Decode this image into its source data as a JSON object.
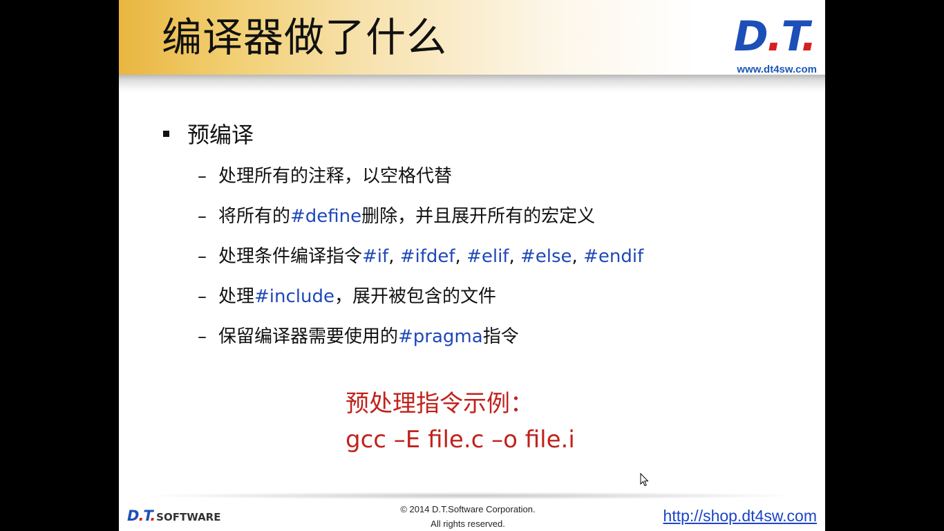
{
  "slide": {
    "title": "编译器做了什么",
    "logo": {
      "letters_blue": "D",
      "dot1": ".",
      "letter_t": "T",
      "dot2": ".",
      "url": "www.dt4sw.com"
    },
    "bullet": "预编译",
    "items": [
      {
        "parts": [
          {
            "text": "处理所有的注释，以空格代替",
            "code": false
          }
        ]
      },
      {
        "parts": [
          {
            "text": "将所有的",
            "code": false
          },
          {
            "text": "#define",
            "code": true
          },
          {
            "text": "删除，并且展开所有的宏定义",
            "code": false
          }
        ]
      },
      {
        "parts": [
          {
            "text": "处理条件编译指令",
            "code": false
          },
          {
            "text": "#if",
            "code": true
          },
          {
            "text": ", ",
            "code": false
          },
          {
            "text": "#ifdef",
            "code": true
          },
          {
            "text": ", ",
            "code": false
          },
          {
            "text": "#elif",
            "code": true
          },
          {
            "text": ", ",
            "code": false
          },
          {
            "text": "#else",
            "code": true
          },
          {
            "text": ", ",
            "code": false
          },
          {
            "text": "#endif",
            "code": true
          }
        ]
      },
      {
        "parts": [
          {
            "text": "处理",
            "code": false
          },
          {
            "text": "#include",
            "code": true
          },
          {
            "text": "，展开被包含的文件",
            "code": false
          }
        ]
      },
      {
        "parts": [
          {
            "text": "保留编译器需要使用的",
            "code": false
          },
          {
            "text": "#pragma",
            "code": true
          },
          {
            "text": "指令",
            "code": false
          }
        ]
      }
    ],
    "dash": "–",
    "example_label": "预处理指令示例：",
    "example_command": "gcc –E file.c –o file.i",
    "footer": {
      "logo_d": "D",
      "logo_dot": ".",
      "logo_t": "T",
      "logo_dot2": ".",
      "logo_word": "SOFTWARE",
      "copyright_line1": "© 2014 D.T.Software Corporation.",
      "copyright_line2": "All rights reserved.",
      "shop_link": "http://shop.dt4sw.com"
    }
  },
  "colors": {
    "keyword": "#1f48b8",
    "example": "#c0221b",
    "header_gold": "#e9b63f",
    "logo_blue": "#1d4fb8",
    "logo_red": "#d62020"
  },
  "icons": {
    "cursor": "mouse-pointer-icon"
  }
}
